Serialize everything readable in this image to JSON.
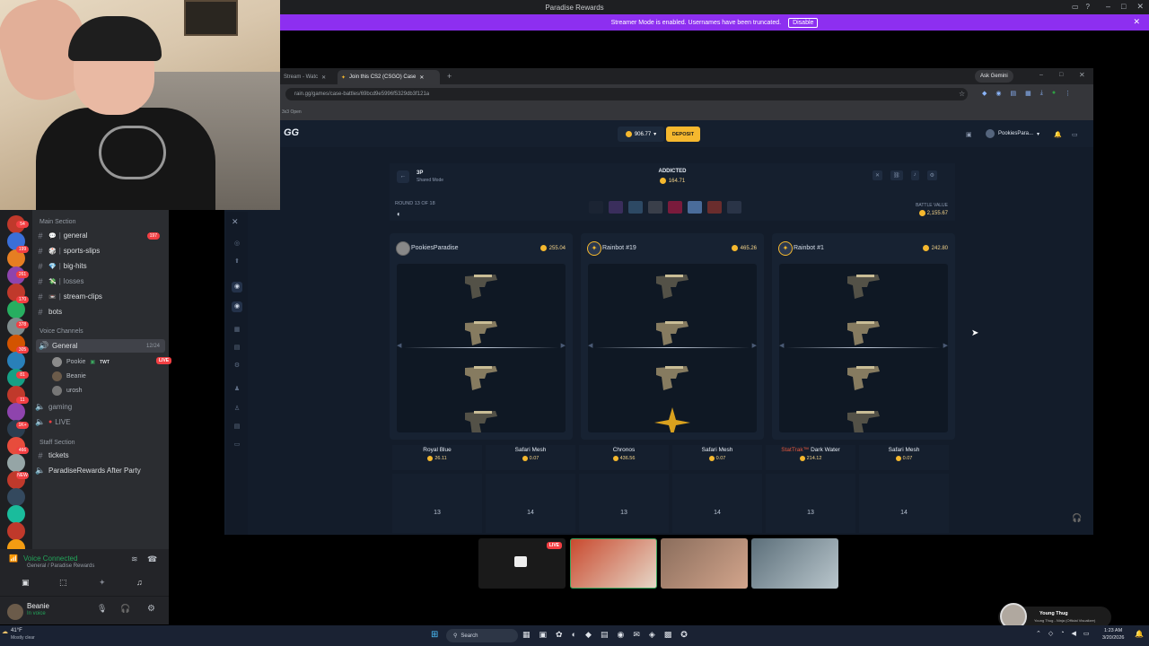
{
  "discord": {
    "window_title": "Paradise Rewards",
    "banner_text": "Streamer Mode is enabled. Usernames have been truncated.",
    "banner_button": "Disable",
    "categories": {
      "main": "Main Section",
      "voice": "Voice Channels",
      "staff": "Staff Section"
    },
    "channels": [
      {
        "label": "general",
        "badge": "197"
      },
      {
        "label": "sports-slips",
        "badge": ""
      },
      {
        "label": "big-hits",
        "badge": ""
      },
      {
        "label": "losses",
        "badge": ""
      },
      {
        "label": "stream-clips",
        "badge": ""
      },
      {
        "label": "bots",
        "badge": ""
      }
    ],
    "voice_channel": {
      "label": "General",
      "count": "12/24"
    },
    "voice_users": [
      {
        "name": "Pookie",
        "tag": "TWT",
        "badge": "LIVE"
      },
      {
        "name": "Beanie",
        "tag": "",
        "badge": ""
      },
      {
        "name": "urosh",
        "tag": "",
        "badge": ""
      }
    ],
    "other_voice": [
      "gaming",
      "LIVE"
    ],
    "staff_channels": [
      "tickets",
      "ParadiseRewards After Party"
    ],
    "voice_status": "Voice Connected",
    "voice_location": "General / Paradise Rewards",
    "user": {
      "name": "Beanie",
      "status": "In voice"
    },
    "guild_badges": [
      "54",
      "199",
      "261",
      "170",
      "378",
      "305",
      "81",
      "11",
      "1K+",
      "466",
      "NEW"
    ]
  },
  "browser": {
    "tabs": [
      "Stream - Watc",
      "Join this CS2 (CSGO) Case"
    ],
    "url": "rain.gg/games/case-battles/69bcd9e5996f5329db3f121a",
    "bookmark": "3x3 Open",
    "gemini": "Ask Gemini"
  },
  "site": {
    "logo": "GG",
    "balance": "906.77",
    "deposit": "DEPOSIT",
    "user": "PookiesPara..."
  },
  "battle": {
    "mode": "3P",
    "mode_sub": "Shared Mode",
    "round_label": "ROUND 13 OF 18",
    "title": "ADDICTED",
    "title_value": "164.71",
    "battle_value_label": "BATTLE VALUE",
    "battle_value": "2,155.67",
    "players": [
      {
        "name": "PookiesParadise",
        "value": "255.04"
      },
      {
        "name": "Rainbot #19",
        "value": "465.26"
      },
      {
        "name": "Rainbot #1",
        "value": "242.80"
      }
    ],
    "items": [
      {
        "name": "Royal Blue",
        "prefix": "",
        "value": "26.11"
      },
      {
        "name": "Safari Mesh",
        "prefix": "",
        "value": "0.07"
      },
      {
        "name": "Chronos",
        "prefix": "",
        "value": "436.56"
      },
      {
        "name": "Safari Mesh",
        "prefix": "",
        "value": "0.07"
      },
      {
        "name": "Dark Water",
        "prefix": "StatTrak™",
        "value": "214.12"
      },
      {
        "name": "Safari Mesh",
        "prefix": "",
        "value": "0.07"
      }
    ],
    "tile_numbers": [
      "13",
      "14",
      "13",
      "14",
      "13",
      "14"
    ]
  },
  "stream": {
    "live": "LIVE"
  },
  "music": {
    "artist": "Young Thug",
    "track": "Young Thug - Ninja (Official Visualizer)"
  },
  "taskbar": {
    "weather_temp": "41°F",
    "weather_desc": "Mostly clear",
    "search": "Search",
    "time": "1:23 AM",
    "date": "3/20/2026"
  },
  "colors": {
    "accent": "#f5b82e",
    "banner": "#8d2ff0",
    "site_bg": "#131c2a"
  }
}
